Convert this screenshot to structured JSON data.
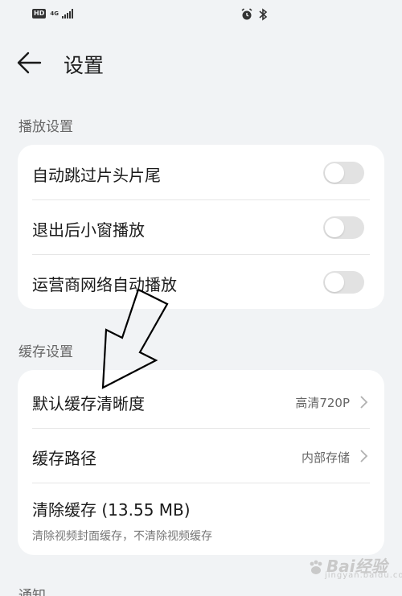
{
  "status_bar": {
    "hd_label": "HD",
    "network_label": "4G",
    "alarm_icon": "alarm-icon",
    "bluetooth_icon": "bluetooth-icon"
  },
  "header": {
    "back_icon": "arrow-left-icon",
    "title": "设置"
  },
  "playback": {
    "section_title": "播放设置",
    "items": [
      {
        "label": "自动跳过片头片尾",
        "toggle": false
      },
      {
        "label": "退出后小窗播放",
        "toggle": false
      },
      {
        "label": "运营商网络自动播放",
        "toggle": false
      }
    ]
  },
  "cache": {
    "section_title": "缓存设置",
    "items": [
      {
        "label": "默认缓存清晰度",
        "value": "高清720P"
      },
      {
        "label": "缓存路径",
        "value": "内部存储"
      }
    ],
    "clear": {
      "label": "清除缓存 (13.55 MB)",
      "subtitle": "清除视频封面缓存，不清除视频缓存"
    }
  },
  "next_section": {
    "title": "通知"
  },
  "watermark": {
    "text": "Bai经验",
    "sub": "jingyan.baidu.com"
  },
  "colors": {
    "background": "#f1f3f5",
    "card": "#ffffff",
    "toggle_off": "#e2e2e2",
    "annotation_arrow": "#000000"
  }
}
